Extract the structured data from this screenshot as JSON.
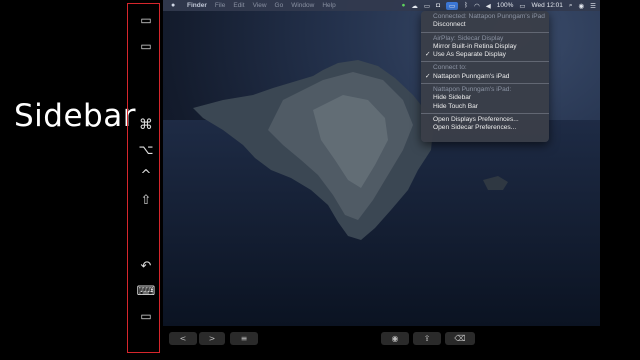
{
  "overlay_label": "Sidebar",
  "sidebar": {
    "icons": [
      "menubar-toggle-icon",
      "dock-toggle-icon",
      "command-key-icon",
      "option-key-icon",
      "control-key-icon",
      "shift-key-icon",
      "undo-icon",
      "keyboard-icon",
      "disconnect-display-icon"
    ],
    "glyphs": [
      "▭",
      "▭",
      "⌘",
      "⌥",
      "^",
      "⇧",
      "↶",
      "⌨",
      "▭"
    ]
  },
  "menubar": {
    "apple": "",
    "app": "Finder",
    "items": [
      "File",
      "Edit",
      "View",
      "Go",
      "Window",
      "Help"
    ],
    "battery": "100%",
    "clock": "Wed 12:01"
  },
  "dropdown": {
    "connected_header": "Connected: Nattapon Punngam's iPad",
    "disconnect": "Disconnect",
    "airplay_header": "AirPlay: Sidecar Display",
    "mirror": "Mirror Built-in Retina Display",
    "separate": "Use As Separate Display",
    "connect_header": "Connect to:",
    "device": "Nattapon Punngam's iPad",
    "ipad_header": "Nattapon Punngam's iPad:",
    "hide_sidebar": "Hide Sidebar",
    "hide_touchbar": "Hide Touch Bar",
    "open_displays": "Open Displays Preferences...",
    "open_sidecar": "Open Sidecar Preferences...",
    "checkmark": "✓"
  },
  "touchbar": {
    "back": "<",
    "forward": ">",
    "menu": "≡",
    "preview": "◉",
    "share": "⇪",
    "tag": "⌫"
  }
}
